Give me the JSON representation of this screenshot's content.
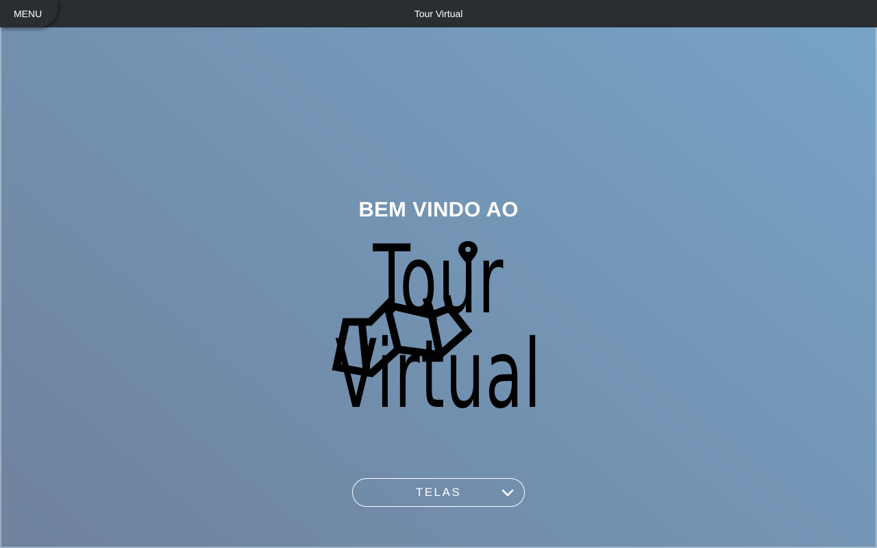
{
  "topbar": {
    "menu_label": "MENU",
    "title": "Tour Virtual"
  },
  "hero": {
    "welcome": "BEM VINDO AO",
    "logo_text": "Tour Virtual"
  },
  "dropdown": {
    "label": "TELAS",
    "icon": "chevron-down-icon"
  }
}
